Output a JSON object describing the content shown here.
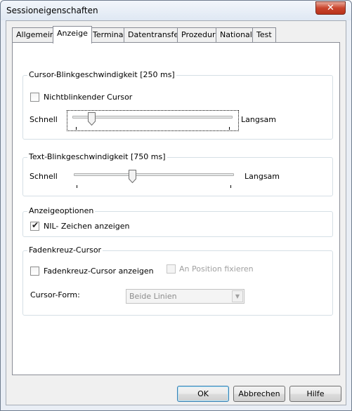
{
  "window": {
    "title": "Sessioneigenschaften",
    "close_glyph": "✕"
  },
  "tabs": [
    {
      "label": "Allgemein",
      "active": false
    },
    {
      "label": "Anzeige",
      "active": true
    },
    {
      "label": "Terminal",
      "active": false
    },
    {
      "label": "Datentransfer",
      "active": false
    },
    {
      "label": "Prozedur",
      "active": false
    },
    {
      "label": "National",
      "active": false
    },
    {
      "label": "Test",
      "active": false
    }
  ],
  "cursor_blink": {
    "legend": "Cursor-Blinkgeschwindigkeit [250 ms]",
    "nonblink_label": "Nichtblinkender Cursor",
    "nonblink_checked": false,
    "left_label": "Schnell",
    "right_label": "Langsam",
    "slider_level": 0.1
  },
  "text_blink": {
    "legend": "Text-Blinkgeschwindigkeit [750 ms]",
    "left_label": "Schnell",
    "right_label": "Langsam",
    "slider_level": 0.36
  },
  "display_options": {
    "legend": "Anzeigeoptionen",
    "nil_label": "NIL- Zeichen anzeigen",
    "nil_checked": true
  },
  "crosshair": {
    "legend": "Fadenkreuz-Cursor",
    "show_label": "Fadenkreuz-Cursor anzeigen",
    "show_checked": false,
    "fix_label": "An Position fixieren",
    "fix_checked": false,
    "form_label": "Cursor-Form:",
    "form_value": "Beide Linien"
  },
  "buttons": {
    "ok": "OK",
    "cancel": "Abbrechen",
    "help": "Hilfe"
  },
  "colors": {
    "focus_border": "#3c7fb1",
    "disabled_text": "#a0a0a0"
  }
}
